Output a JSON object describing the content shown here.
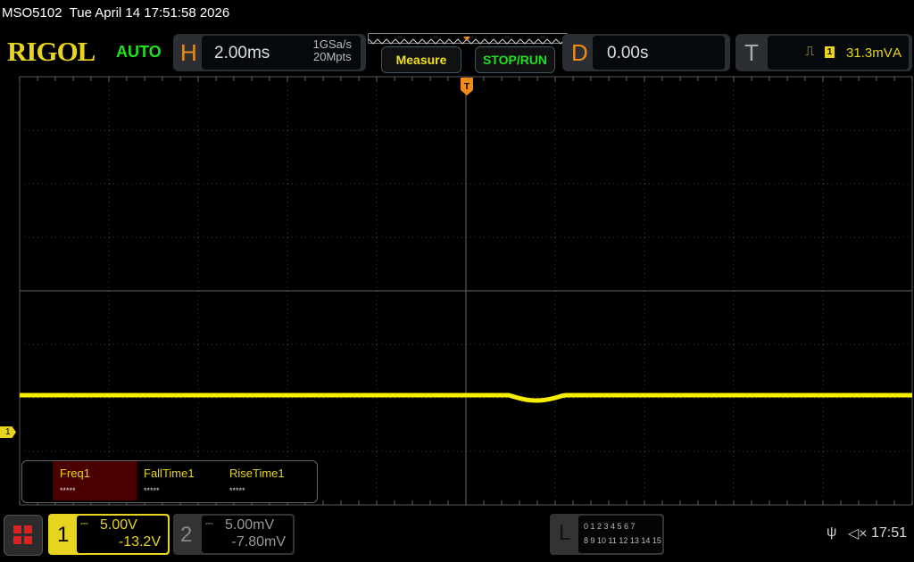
{
  "status_bar": {
    "model": "MSO5102",
    "datetime": "Tue April 14 17:51:58 2026"
  },
  "header": {
    "logo": "RIGOL",
    "trigger_status": "AUTO",
    "horizontal": {
      "letter": "H",
      "timebase": "2.00ms",
      "sample_rate": "1GSa/s",
      "memory_depth": "20Mpts"
    },
    "measure_label": "Measure",
    "stoprun_label": "STOP/RUN",
    "delay": {
      "letter": "D",
      "value": "0.00s"
    },
    "trigger": {
      "letter": "T",
      "edge_icon": "rising-edge-icon",
      "source": "1",
      "level": "31.3mV",
      "mode": "A"
    }
  },
  "waveform": {
    "channel_marker": "1",
    "trace_color": "#f5ee00",
    "grid_divisions": {
      "horizontal": 10,
      "vertical": 8
    }
  },
  "measurements": [
    {
      "label": "Freq1",
      "value": "*****",
      "selected": true
    },
    {
      "label": "FallTime1",
      "value": "*****"
    },
    {
      "label": "RiseTime1",
      "value": "*****"
    }
  ],
  "channels": [
    {
      "number": "1",
      "coupling_icon": "dc-coupling-icon",
      "scale": "5.00V",
      "offset": "-13.2V",
      "color": "#e6d421",
      "active": true
    },
    {
      "number": "2",
      "coupling_icon": "dc-coupling-icon",
      "scale": "5.00mV",
      "offset": "-7.80mV",
      "active": false
    }
  ],
  "logic": {
    "letter": "L",
    "row1": "0 1 2 3  4 5 6 7",
    "row2": "8 9 10 11 12 13 14 15"
  },
  "system": {
    "time": "17:51",
    "usb_icon": "usb-icon",
    "sound_icon": "mute-icon"
  }
}
